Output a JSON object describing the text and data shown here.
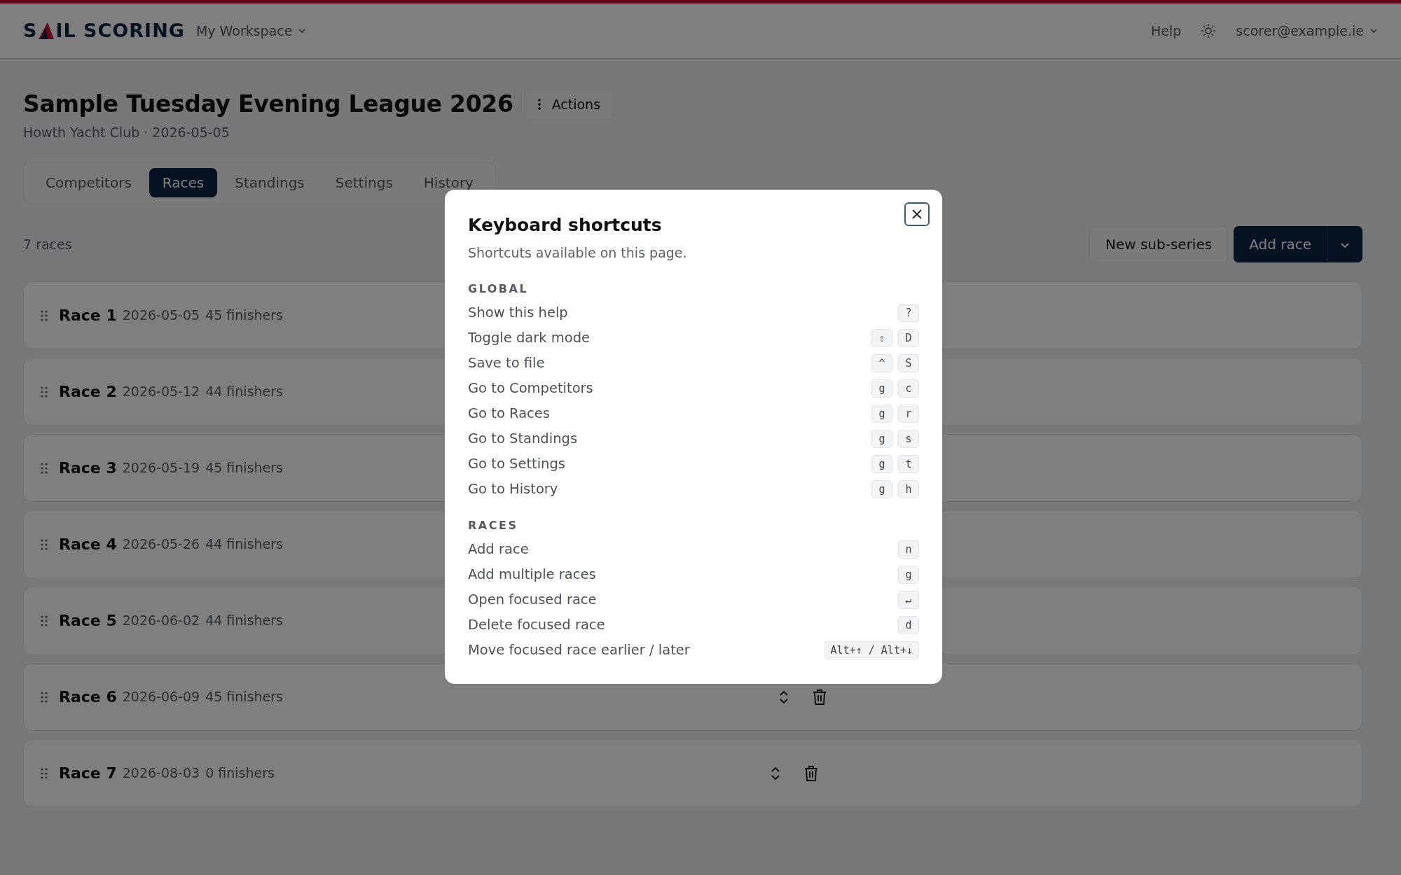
{
  "navbar": {
    "brand_start": "S",
    "brand_end": "IL SCORING",
    "workspace": "My Workspace",
    "help": "Help",
    "user": "scorer@example.ie"
  },
  "header": {
    "title": "Sample Tuesday Evening League 2026",
    "actions": "Actions",
    "subtitle": "Howth Yacht Club · 2026-05-05"
  },
  "tabs": [
    {
      "label": "Competitors",
      "selected": false
    },
    {
      "label": "Races",
      "selected": true
    },
    {
      "label": "Standings",
      "selected": false
    },
    {
      "label": "Settings",
      "selected": false
    },
    {
      "label": "History",
      "selected": false
    }
  ],
  "race_count": "7 races",
  "toolbar": {
    "new_sub_series": "New sub-series",
    "add_race": "Add race"
  },
  "races": [
    {
      "name": "Race 1",
      "date": "2026-05-05",
      "finishers": "45 finishers"
    },
    {
      "name": "Race 2",
      "date": "2026-05-12",
      "finishers": "44 finishers"
    },
    {
      "name": "Race 3",
      "date": "2026-05-19",
      "finishers": "45 finishers"
    },
    {
      "name": "Race 4",
      "date": "2026-05-26",
      "finishers": "44 finishers"
    },
    {
      "name": "Race 5",
      "date": "2026-06-02",
      "finishers": "44 finishers"
    },
    {
      "name": "Race 6",
      "date": "2026-06-09",
      "finishers": "45 finishers"
    },
    {
      "name": "Race 7",
      "date": "2026-08-03",
      "finishers": "0 finishers"
    }
  ],
  "modal": {
    "title": "Keyboard shortcuts",
    "subtitle": "Shortcuts available on this page.",
    "sections": [
      {
        "heading": "GLOBAL",
        "shortcuts": [
          {
            "label": "Show this help",
            "keys": [
              "?"
            ]
          },
          {
            "label": "Toggle dark mode",
            "keys": [
              "⇧",
              "D"
            ]
          },
          {
            "label": "Save to file",
            "keys": [
              "^",
              "S"
            ]
          },
          {
            "label": "Go to Competitors",
            "keys": [
              "g",
              "c"
            ]
          },
          {
            "label": "Go to Races",
            "keys": [
              "g",
              "r"
            ]
          },
          {
            "label": "Go to Standings",
            "keys": [
              "g",
              "s"
            ]
          },
          {
            "label": "Go to Settings",
            "keys": [
              "g",
              "t"
            ]
          },
          {
            "label": "Go to History",
            "keys": [
              "g",
              "h"
            ]
          }
        ]
      },
      {
        "heading": "RACES",
        "shortcuts": [
          {
            "label": "Add race",
            "keys": [
              "n"
            ]
          },
          {
            "label": "Add multiple races",
            "keys": [
              "g"
            ]
          },
          {
            "label": "Open focused race",
            "keys": [
              "↵"
            ]
          },
          {
            "label": "Delete focused race",
            "keys": [
              "d"
            ]
          },
          {
            "label": "Move focused race earlier / later",
            "keys": [
              "Alt+↑ / Alt+↓"
            ]
          }
        ]
      }
    ]
  }
}
